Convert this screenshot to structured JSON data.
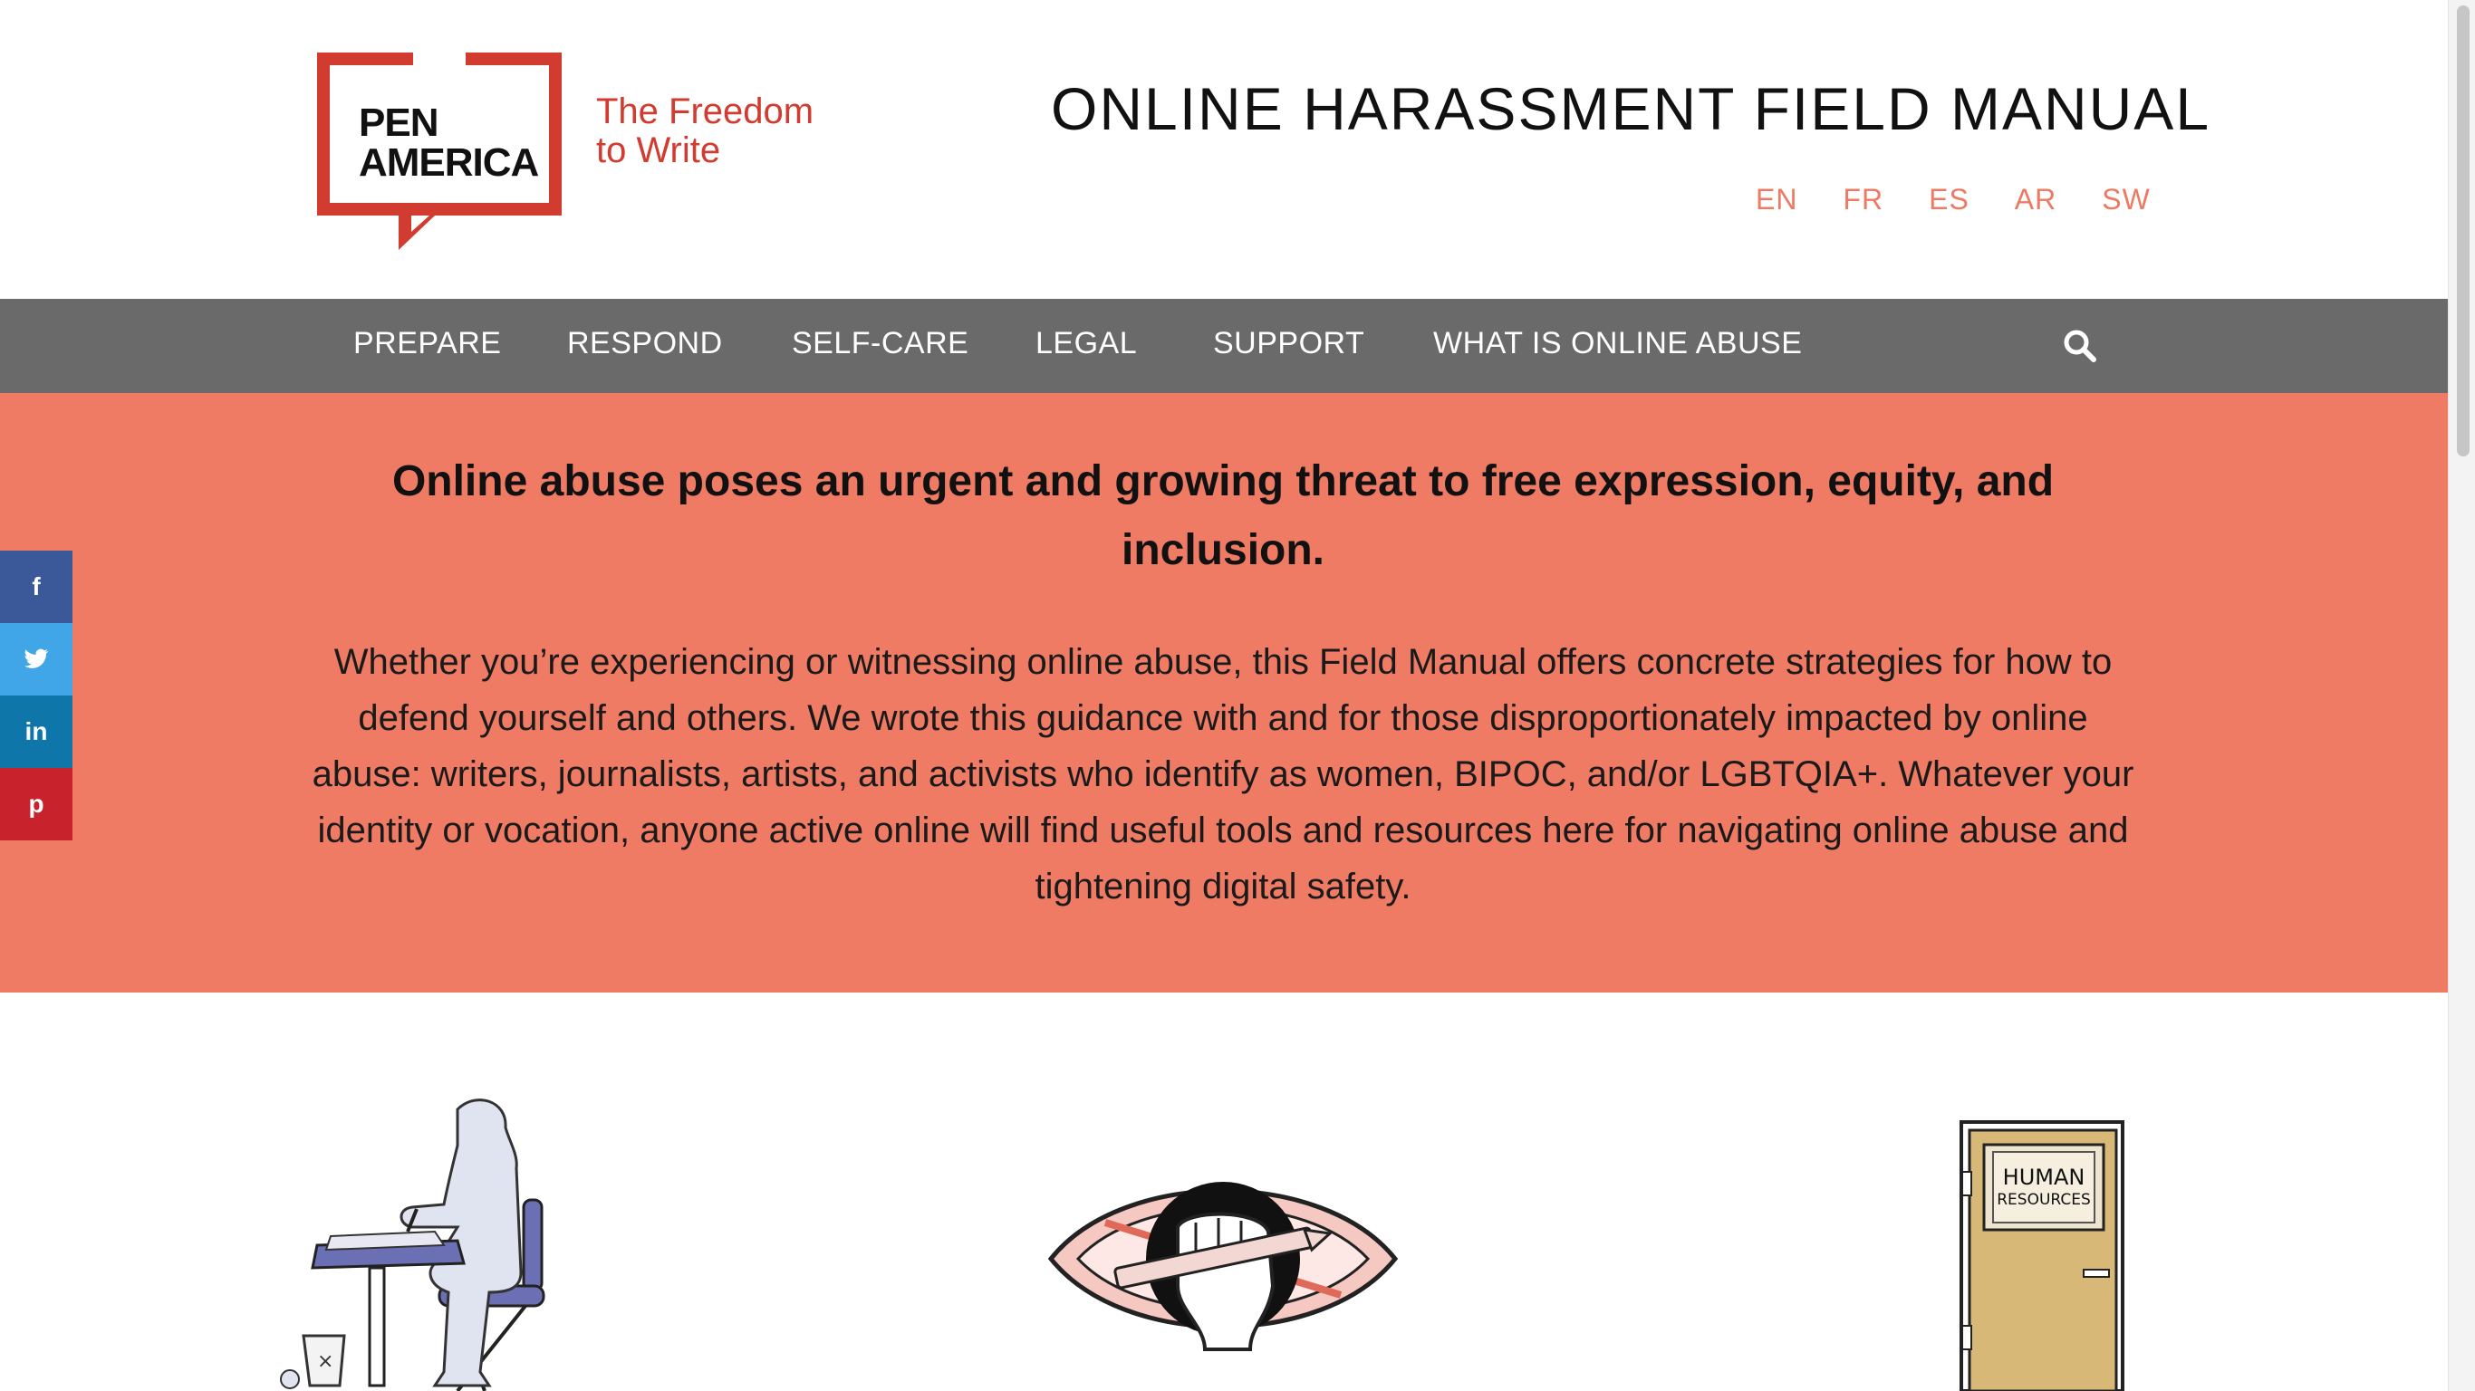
{
  "logo": {
    "name_line1": "PEN",
    "name_line2": "AMERICA",
    "tagline_line1": "The Freedom",
    "tagline_line2": "to Write",
    "brand_color": "#d23b2f"
  },
  "site_title": "ONLINE HARASSMENT FIELD MANUAL",
  "languages": [
    "EN",
    "FR",
    "ES",
    "AR",
    "SW"
  ],
  "nav": {
    "items": [
      "PREPARE",
      "RESPOND",
      "SELF-CARE",
      "LEGAL",
      "SUPPORT",
      "WHAT IS ONLINE ABUSE"
    ],
    "background": "#6a6a6a",
    "search_icon": "search-icon"
  },
  "hero": {
    "background": "#ef7b64",
    "title": "Online abuse poses an urgent and growing threat to free expression, equity, and inclusion.",
    "body": "Whether you’re experiencing or witnessing online abuse, this Field Manual offers concrete strategies for how to defend yourself and others. We wrote this guidance with and for those disproportionately impacted by online abuse: writers, journalists, artists, and activists who identify as women, BIPOC, and/or LGBTQIA+. Whatever your identity or vocation, anyone active online will find useful tools and resources here for navigating online abuse and tightening digital safety."
  },
  "social": [
    {
      "network": "facebook",
      "glyph": "f",
      "color": "#3b5998"
    },
    {
      "network": "twitter",
      "glyph": "t",
      "color": "#41a6e8"
    },
    {
      "network": "linkedin",
      "glyph": "in",
      "color": "#0e76a8"
    },
    {
      "network": "pinterest",
      "glyph": "p",
      "color": "#c8232c"
    }
  ],
  "illustrations": {
    "door_sign_line1": "HUMAN",
    "door_sign_line2": "RESOURCES"
  }
}
